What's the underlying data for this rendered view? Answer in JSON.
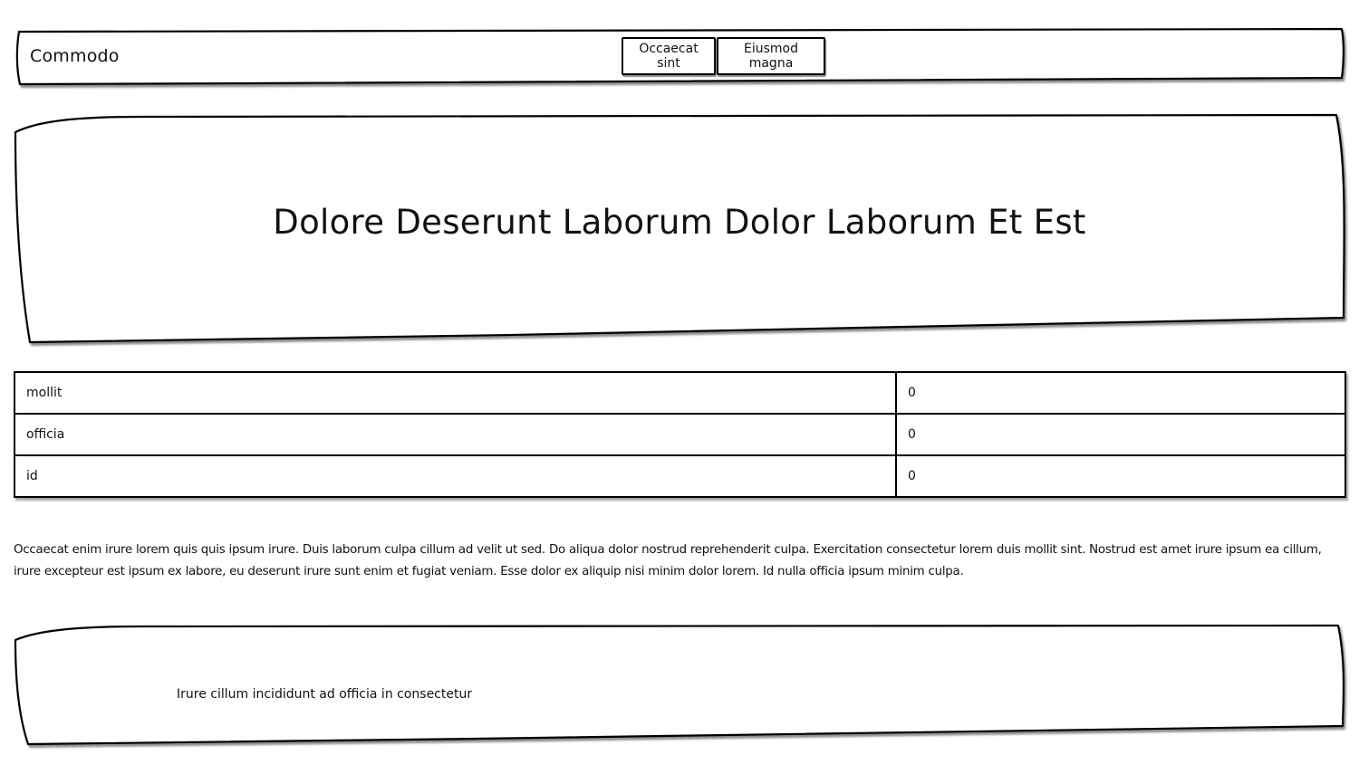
{
  "header": {
    "brand": "Commodo",
    "nav": [
      {
        "label": "Occaecat sint"
      },
      {
        "label": "Eiusmod magna"
      }
    ]
  },
  "hero": {
    "title": "Dolore Deserunt Laborum Dolor Laborum Et Est"
  },
  "table": {
    "rows": [
      {
        "key": "mollit",
        "value": "0"
      },
      {
        "key": "officia",
        "value": "0"
      },
      {
        "key": "id",
        "value": "0"
      }
    ]
  },
  "body": {
    "text": "Occaecat enim irure lorem quis quis ipsum irure. Duis laborum culpa cillum ad velit ut sed. Do aliqua dolor nostrud reprehenderit culpa. Exercitation consectetur lorem duis mollit sint. Nostrud est amet irure ipsum ea cillum, irure excepteur est ipsum ex labore, eu deserunt irure sunt enim et fugiat veniam. Esse dolor ex aliquip nisi minim dolor lorem. Id nulla officia ipsum minim culpa."
  },
  "footer": {
    "text": "Irure cillum incididunt ad officia in consectetur"
  }
}
